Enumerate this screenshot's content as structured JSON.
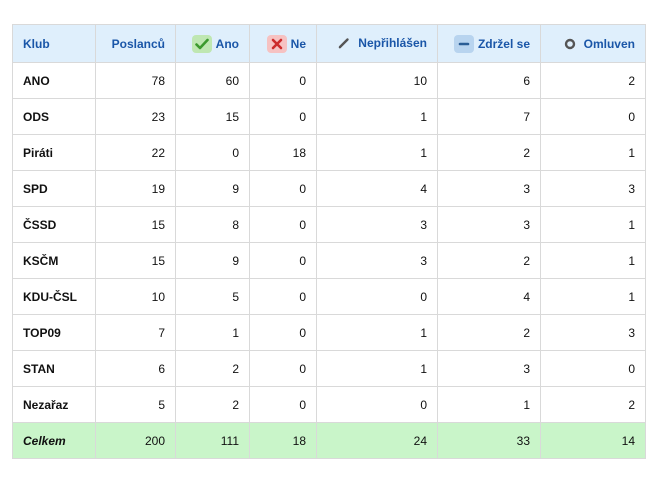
{
  "columns": {
    "club": "Klub",
    "deputies": "Poslanců",
    "yes": "Ano",
    "no": "Ne",
    "not_logged": "Nepřihlášen",
    "abstained": "Zdržel se",
    "excused": "Omluven"
  },
  "icons": {
    "yes": "check-icon",
    "no": "cross-icon",
    "not_logged": "pencil-icon",
    "abstained": "minus-icon",
    "excused": "circle-icon"
  },
  "colors": {
    "header_bg": "#dfeffc",
    "header_text": "#1a56a8",
    "total_bg": "#c9f5c9",
    "yes_icon": "#3c9a2e",
    "no_icon": "#cc2b2b"
  },
  "rows": [
    {
      "club": "ANO",
      "deputies": "78",
      "yes": "60",
      "no": "0",
      "not_logged": "10",
      "abstained": "6",
      "excused": "2"
    },
    {
      "club": "ODS",
      "deputies": "23",
      "yes": "15",
      "no": "0",
      "not_logged": "1",
      "abstained": "7",
      "excused": "0"
    },
    {
      "club": "Piráti",
      "deputies": "22",
      "yes": "0",
      "no": "18",
      "not_logged": "1",
      "abstained": "2",
      "excused": "1"
    },
    {
      "club": "SPD",
      "deputies": "19",
      "yes": "9",
      "no": "0",
      "not_logged": "4",
      "abstained": "3",
      "excused": "3"
    },
    {
      "club": "ČSSD",
      "deputies": "15",
      "yes": "8",
      "no": "0",
      "not_logged": "3",
      "abstained": "3",
      "excused": "1"
    },
    {
      "club": "KSČM",
      "deputies": "15",
      "yes": "9",
      "no": "0",
      "not_logged": "3",
      "abstained": "2",
      "excused": "1"
    },
    {
      "club": "KDU-ČSL",
      "deputies": "10",
      "yes": "5",
      "no": "0",
      "not_logged": "0",
      "abstained": "4",
      "excused": "1"
    },
    {
      "club": "TOP09",
      "deputies": "7",
      "yes": "1",
      "no": "0",
      "not_logged": "1",
      "abstained": "2",
      "excused": "3"
    },
    {
      "club": "STAN",
      "deputies": "6",
      "yes": "2",
      "no": "0",
      "not_logged": "1",
      "abstained": "3",
      "excused": "0"
    },
    {
      "club": "Nezařaz",
      "deputies": "5",
      "yes": "2",
      "no": "0",
      "not_logged": "0",
      "abstained": "1",
      "excused": "2"
    }
  ],
  "total": {
    "club": "Celkem",
    "deputies": "200",
    "yes": "111",
    "no": "18",
    "not_logged": "24",
    "abstained": "33",
    "excused": "14"
  }
}
